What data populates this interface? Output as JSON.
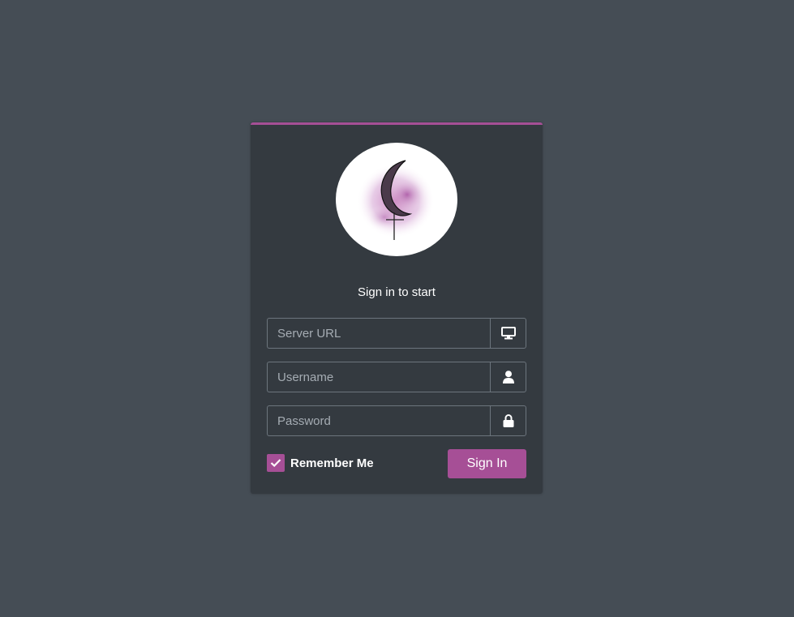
{
  "login": {
    "subtitle": "Sign in to start",
    "server_url": {
      "value": "",
      "placeholder": "Server URL",
      "icon": "desktop-icon"
    },
    "username": {
      "value": "",
      "placeholder": "Username",
      "icon": "user-icon"
    },
    "password": {
      "value": "",
      "placeholder": "Password",
      "icon": "lock-icon"
    },
    "remember_me": {
      "label": "Remember Me",
      "checked": true
    },
    "sign_in_label": "Sign In"
  },
  "colors": {
    "background": "#454d55",
    "card": "#343a40",
    "accent": "#a64f96",
    "input_border": "#6c757d"
  }
}
